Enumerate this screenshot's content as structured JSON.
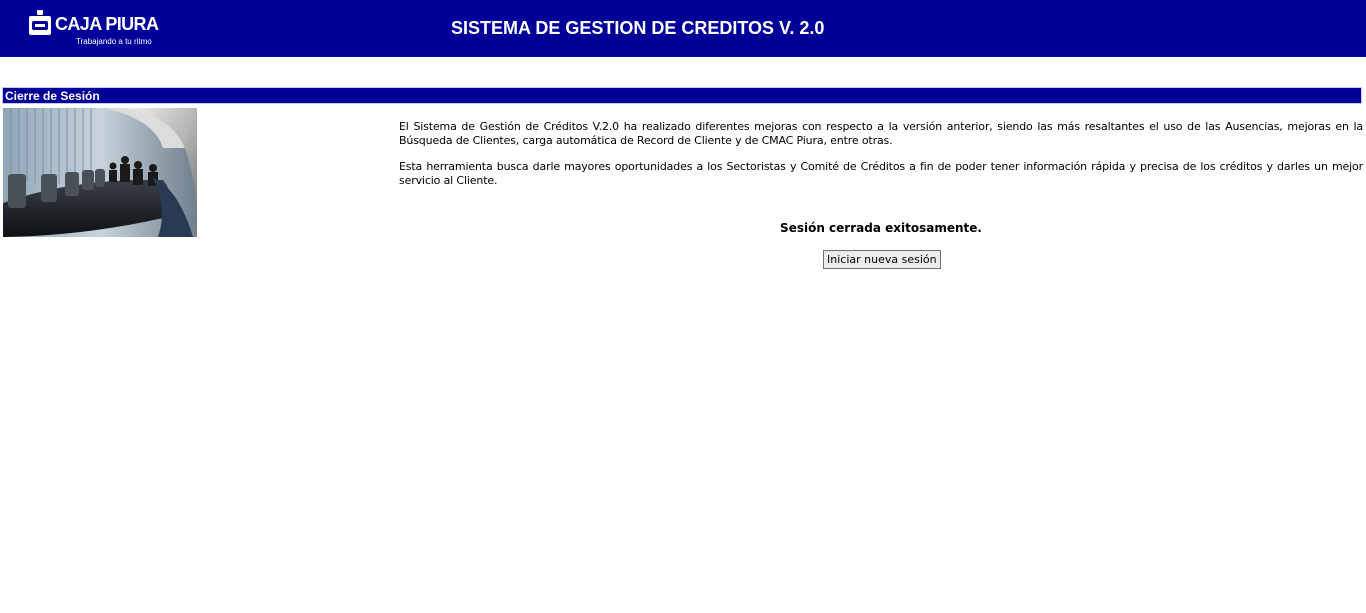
{
  "header": {
    "logo_name": "CAJA PIURA",
    "logo_tagline": "Trabajando a tu ritmo",
    "title": "SISTEMA DE GESTION DE CREDITOS V. 2.0",
    "background_color": "#000099"
  },
  "section": {
    "title": "Cierre de Sesión"
  },
  "main": {
    "paragraphs": [
      "El Sistema de Gestión de Créditos V.2.0 ha realizado diferentes mejoras con respecto a la versión anterior, siendo las más resaltantes el uso de las Ausencias, mejoras en la Búsqueda de Clientes, carga automática de Record de Cliente y de CMAC Piura, entre otras.",
      "Esta herramienta busca darle mayores oportunidades a los Sectoristas y Comité de Créditos a fin de poder tener información rápida y precisa de los créditos y darles un mejor servicio al Cliente."
    ],
    "status_message": "Sesión cerrada exitosamente.",
    "new_session_button": "Iniciar nueva sesión"
  },
  "icons": {
    "logo": "caja-piura-logo-icon",
    "photo": "conference-room-photo"
  }
}
